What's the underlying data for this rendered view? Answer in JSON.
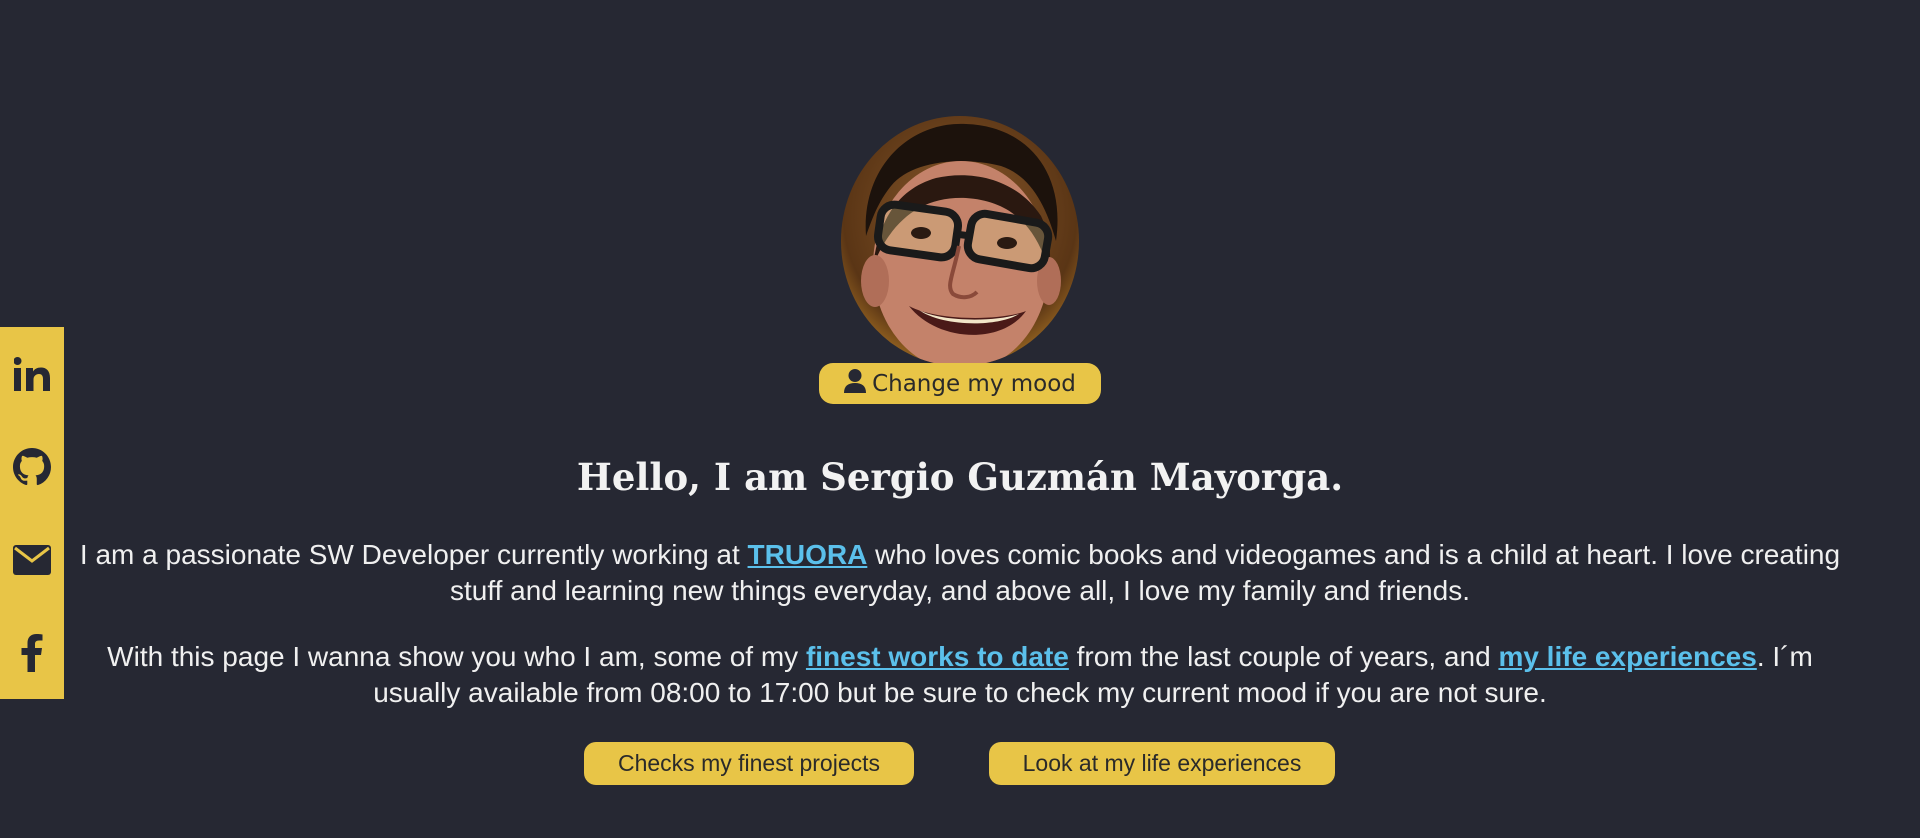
{
  "social": {
    "items": [
      {
        "name": "linkedin",
        "icon": "linkedin-icon"
      },
      {
        "name": "github",
        "icon": "github-icon"
      },
      {
        "name": "email",
        "icon": "envelope-icon"
      },
      {
        "name": "facebook",
        "icon": "facebook-icon"
      }
    ],
    "bar_color": "#e8c547"
  },
  "profile": {
    "avatar_icon": "profile-photo",
    "mood_button_icon": "user-icon",
    "mood_button_label": "Change my mood"
  },
  "intro": {
    "heading": "Hello, I am Sergio Guzmán Mayorga.",
    "p1_before": "I am a passionate SW Developer currently working at ",
    "p1_link": "TRUORA",
    "p1_after": " who loves comic books and videogames and is a child at heart. I love creating stuff and learning new things everyday, and above all, I love my family and friends.",
    "p2_before": "With this page I wanna show you who I am, some of my ",
    "p2_link1": "finest works to date",
    "p2_middle": " from the last couple of years, and ",
    "p2_link2": "my life experiences",
    "p2_after": ". I´m usually available from 08:00 to 17:00 but be sure to check my current mood if you are not sure."
  },
  "actions": {
    "projects_label": "Checks my finest projects",
    "life_label": "Look at my life experiences"
  },
  "colors": {
    "background": "#262833",
    "accent": "#e8c547",
    "link": "#5bc0eb"
  }
}
